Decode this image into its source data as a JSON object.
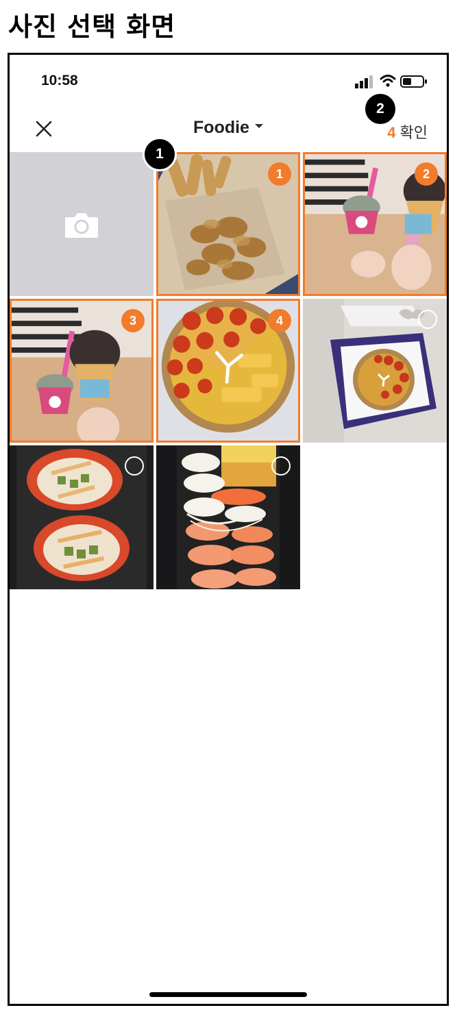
{
  "page_heading": "사진 선택 화면",
  "status_bar": {
    "time": "10:58"
  },
  "navbar": {
    "album_title": "Foodie",
    "confirm_count": "4",
    "confirm_label": "확인"
  },
  "callouts": {
    "one": "1",
    "two": "2"
  },
  "photos": [
    {
      "kind": "camera"
    },
    {
      "kind": "fries-chicken",
      "selected": true,
      "order": "1"
    },
    {
      "kind": "icecream",
      "selected": true,
      "order": "2"
    },
    {
      "kind": "icecream",
      "selected": true,
      "order": "3"
    },
    {
      "kind": "pizza",
      "selected": true,
      "order": "4"
    },
    {
      "kind": "pizza-box",
      "selected": false
    },
    {
      "kind": "sushi-roll",
      "selected": false
    },
    {
      "kind": "sushi",
      "selected": false
    }
  ],
  "colors": {
    "accent": "#f07c2c",
    "camera_bg": "#d1d1d6"
  }
}
